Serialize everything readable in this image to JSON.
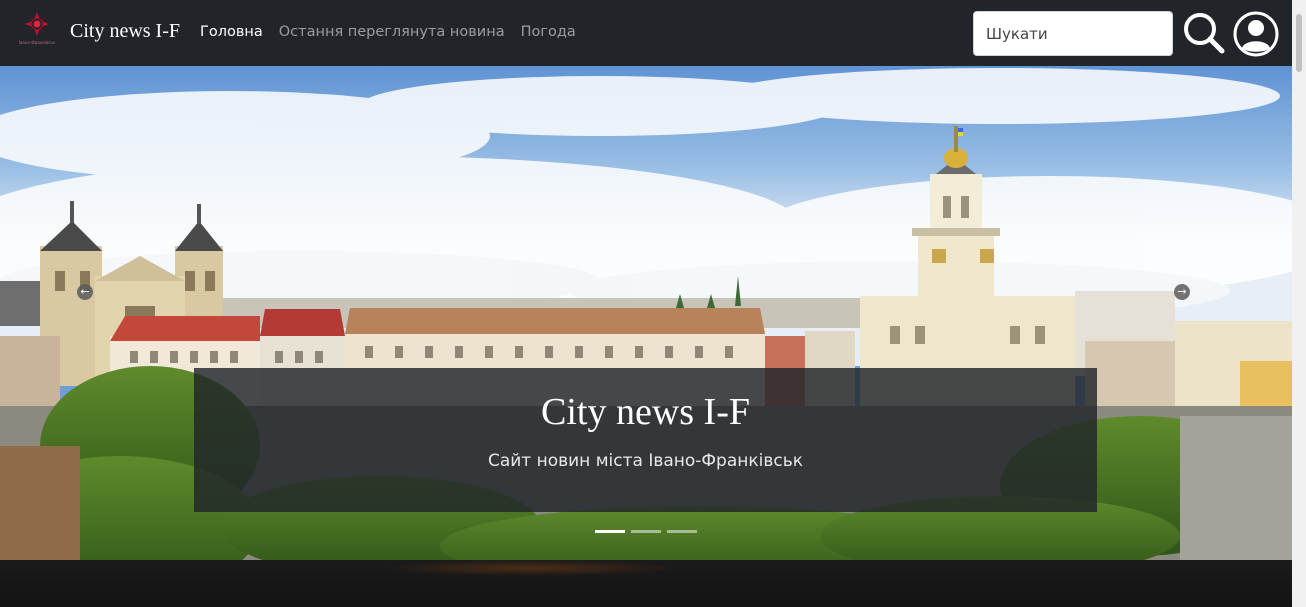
{
  "navbar": {
    "logo": {
      "icon": "city-emblem-icon",
      "caption": "Івано-Франківськ",
      "accent": "#c8102e"
    },
    "brand": "City news I-F",
    "links": [
      {
        "label": "Головна",
        "active": true
      },
      {
        "label": "Остання переглянута новина",
        "active": false
      },
      {
        "label": "Погода",
        "active": false
      }
    ],
    "search": {
      "placeholder": "Шукати",
      "icon": "search-icon"
    },
    "account_icon": "user-circle-icon",
    "background": "#212529"
  },
  "hero": {
    "title": "City news I-F",
    "subtitle": "Сайт новин міста Івано-Франківськ",
    "prev_icon": "arrow-left-icon",
    "next_icon": "arrow-right-icon",
    "slides": 3,
    "active_slide": 1
  }
}
